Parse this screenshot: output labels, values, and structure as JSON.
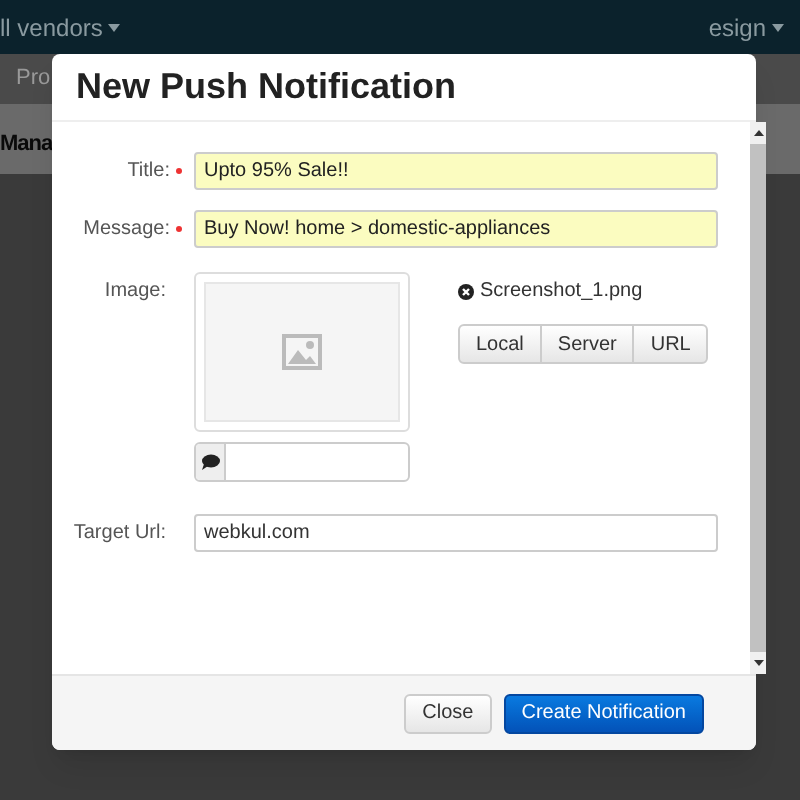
{
  "background": {
    "navbar": {
      "left_menu": "ll vendors",
      "right_menu": "esign"
    },
    "subnav_item": "Pro",
    "page_heading": "Mana"
  },
  "modal": {
    "title": "New Push Notification",
    "fields": [
      {
        "label": "Title:",
        "required": true,
        "value": "Upto 95% Sale!!"
      },
      {
        "label": "Message:",
        "required": true,
        "value": "Buy Now! home > domestic-appliances"
      }
    ],
    "image": {
      "label": "Image:",
      "file_name": "Screenshot_1.png",
      "source_buttons": [
        "Local",
        "Server",
        "URL"
      ]
    },
    "target_url": {
      "label": "Target Url:",
      "value": "webkul.com"
    },
    "buttons": [
      {
        "label": "Close",
        "kind": "secondary"
      },
      {
        "label": "Create Notification",
        "kind": "primary"
      }
    ]
  }
}
